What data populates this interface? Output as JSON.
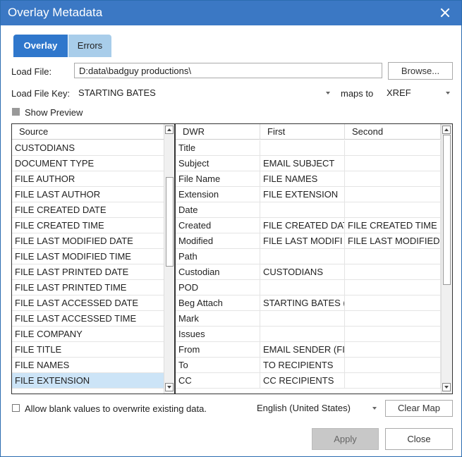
{
  "dialog": {
    "title": "Overlay Metadata"
  },
  "tabs": [
    {
      "label": "Overlay"
    },
    {
      "label": "Errors"
    }
  ],
  "load_file": {
    "label": "Load File:",
    "value": "D:data\\badguy productions\\",
    "browse_label": "Browse..."
  },
  "load_file_key": {
    "label": "Load File Key:",
    "value": "STARTING BATES",
    "maps_to_label": "maps to",
    "maps_to_value": "XREF"
  },
  "show_preview": {
    "label": "Show Preview",
    "checked": false
  },
  "source_list": {
    "header": "Source",
    "items": [
      "CUSTODIANS",
      "DOCUMENT TYPE",
      "FILE AUTHOR",
      "FILE LAST AUTHOR",
      "FILE CREATED DATE",
      "FILE CREATED TIME",
      "FILE LAST MODIFIED DATE",
      "FILE LAST MODIFIED TIME",
      "FILE LAST PRINTED DATE",
      "FILE LAST PRINTED TIME",
      "FILE LAST ACCESSED DATE",
      "FILE LAST ACCESSED TIME",
      "FILE COMPANY",
      "FILE TITLE",
      "FILE NAMES",
      "FILE EXTENSION"
    ],
    "selected": "FILE EXTENSION"
  },
  "mapping_grid": {
    "headers": {
      "dwr": "DWR",
      "first": "First",
      "second": "Second"
    },
    "rows": [
      {
        "dwr": "Title",
        "first": "",
        "second": ""
      },
      {
        "dwr": "Subject",
        "first": "EMAIL SUBJECT",
        "second": ""
      },
      {
        "dwr": "File Name",
        "first": "FILE NAMES",
        "second": ""
      },
      {
        "dwr": "Extension",
        "first": "FILE EXTENSION",
        "second": ""
      },
      {
        "dwr": "Date",
        "first": "",
        "second": ""
      },
      {
        "dwr": "Created",
        "first": "FILE CREATED DAT",
        "second": "FILE CREATED TIME"
      },
      {
        "dwr": "Modified",
        "first": "FILE LAST MODIFI",
        "second": "FILE LAST MODIFIED"
      },
      {
        "dwr": "Path",
        "first": "",
        "second": ""
      },
      {
        "dwr": "Custodian",
        "first": "CUSTODIANS",
        "second": ""
      },
      {
        "dwr": "POD",
        "first": "",
        "second": ""
      },
      {
        "dwr": "Beg Attach",
        "first": "STARTING BATES (",
        "second": ""
      },
      {
        "dwr": "Mark",
        "first": "",
        "second": ""
      },
      {
        "dwr": "Issues",
        "first": "",
        "second": ""
      },
      {
        "dwr": "From",
        "first": "EMAIL SENDER (FI",
        "second": ""
      },
      {
        "dwr": "To",
        "first": "TO RECIPIENTS",
        "second": ""
      },
      {
        "dwr": "CC",
        "first": "CC RECIPIENTS",
        "second": ""
      }
    ]
  },
  "allow_blank": {
    "label": "Allow blank values to overwrite existing data.",
    "checked": false
  },
  "language": {
    "value": "English (United States)"
  },
  "clear_map_label": "Clear Map",
  "apply_label": "Apply",
  "close_label": "Close",
  "colors": {
    "title_bar": "#3b78c4",
    "tab_active": "#2f77cc",
    "tab_inactive": "#a8cdea",
    "selection": "#cce4f7"
  }
}
